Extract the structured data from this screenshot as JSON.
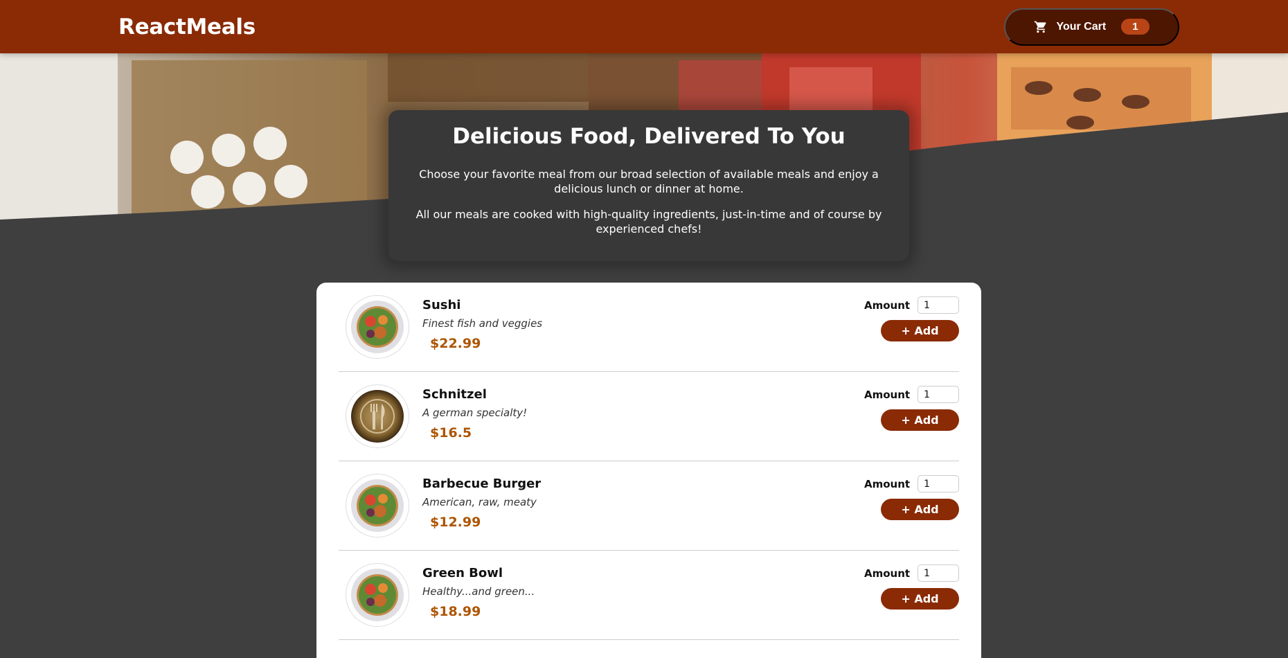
{
  "header": {
    "logo": "ReactMeals",
    "cart_label": "Your Cart",
    "cart_count": "1",
    "cart_icon": "cart-icon"
  },
  "summary": {
    "title": "Delicious Food, Delivered To You",
    "paragraph1": "Choose your favorite meal from our broad selection of available meals and enjoy a delicious lunch or dinner at home.",
    "paragraph2": "All our meals are cooked with high-quality ingredients, just-in-time and of course by experienced chefs!"
  },
  "meals": [
    {
      "name": "Sushi",
      "description": "Finest fish and veggies",
      "price": "$22.99",
      "image": "salad-bowl",
      "amount_label": "Amount",
      "amount_value": "1",
      "add_label": "+ Add"
    },
    {
      "name": "Schnitzel",
      "description": "A german specialty!",
      "price": "$16.5",
      "image": "plate-fork-knife",
      "amount_label": "Amount",
      "amount_value": "1",
      "add_label": "+ Add"
    },
    {
      "name": "Barbecue Burger",
      "description": "American, raw, meaty",
      "price": "$12.99",
      "image": "salad-bowl",
      "amount_label": "Amount",
      "amount_value": "1",
      "add_label": "+ Add"
    },
    {
      "name": "Green Bowl",
      "description": "Healthy...and green...",
      "price": "$18.99",
      "image": "salad-bowl",
      "amount_label": "Amount",
      "amount_value": "1",
      "add_label": "+ Add"
    }
  ],
  "colors": {
    "header_bg": "#8a2b06",
    "cart_bg": "#4d1601",
    "badge_bg": "#b94517",
    "page_bg": "#3f3f3f",
    "price": "#ad5502"
  }
}
